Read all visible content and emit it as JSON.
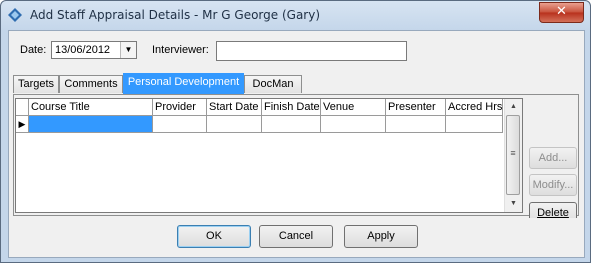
{
  "window": {
    "title": "Add Staff Appraisal Details - Mr G George (Gary)",
    "close_glyph": "✕"
  },
  "form": {
    "date_label": "Date:",
    "date_value": "13/06/2012",
    "interviewer_label": "Interviewer:",
    "interviewer_value": ""
  },
  "tabs": [
    {
      "label": "Targets"
    },
    {
      "label": "Comments"
    },
    {
      "label": "Personal Development"
    },
    {
      "label": "DocMan"
    }
  ],
  "active_tab": "Personal Development",
  "grid": {
    "columns": [
      "Course Title",
      "Provider",
      "Start Date",
      "Finish Date",
      "Venue",
      "Presenter",
      "Accred Hrs"
    ],
    "row_pointer": "▶"
  },
  "side_buttons": {
    "add": "Add...",
    "modify": "Modify...",
    "delete": "Delete"
  },
  "bottom_buttons": {
    "ok": "OK",
    "cancel": "Cancel",
    "apply": "Apply"
  }
}
